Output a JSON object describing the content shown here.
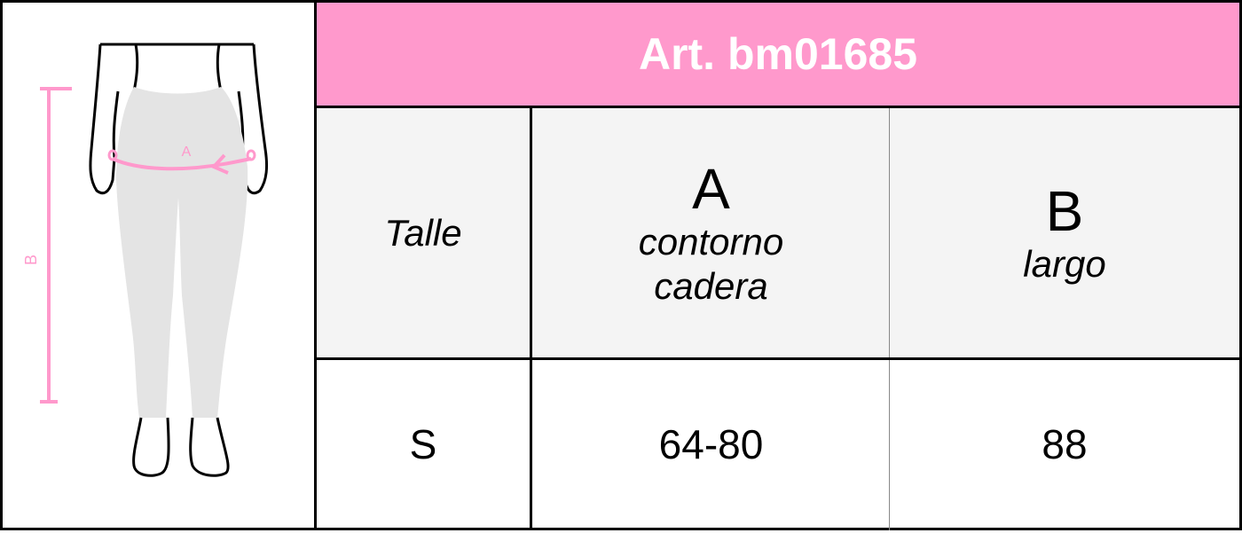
{
  "figure": {
    "label_a": "A",
    "label_b": "B",
    "accent_color": "#ff99cc"
  },
  "table": {
    "title": "Art. bm01685",
    "header_bg": "#ff99cc",
    "columns": [
      {
        "letter": "",
        "label": "Talle"
      },
      {
        "letter": "A",
        "label": "contorno cadera"
      },
      {
        "letter": "B",
        "label": "largo"
      }
    ],
    "rows": [
      [
        "S",
        "64-80",
        "88"
      ]
    ]
  }
}
